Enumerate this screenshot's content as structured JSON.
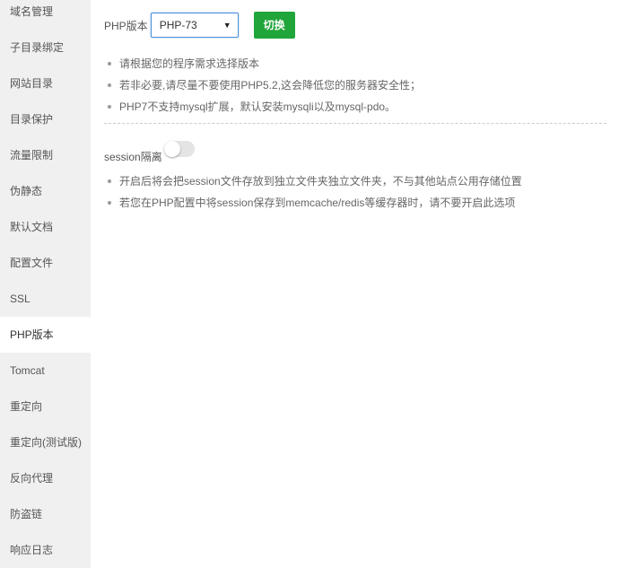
{
  "sidebar": {
    "items": [
      {
        "label": "域名管理"
      },
      {
        "label": "子目录绑定"
      },
      {
        "label": "网站目录"
      },
      {
        "label": "目录保护"
      },
      {
        "label": "流量限制"
      },
      {
        "label": "伪静态"
      },
      {
        "label": "默认文档"
      },
      {
        "label": "配置文件"
      },
      {
        "label": "SSL"
      },
      {
        "label": "PHP版本",
        "active": true
      },
      {
        "label": "Tomcat"
      },
      {
        "label": "重定向"
      },
      {
        "label": "重定向(测试版)"
      },
      {
        "label": "反向代理"
      },
      {
        "label": "防盗链"
      },
      {
        "label": "响应日志"
      }
    ]
  },
  "php": {
    "label": "PHP版本",
    "selected": "PHP-73",
    "switch_label": "切换",
    "tips": [
      "请根据您的程序需求选择版本",
      "若非必要,请尽量不要使用PHP5.2,这会降低您的服务器安全性；",
      "PHP7不支持mysql扩展，默认安装mysqli以及mysql-pdo。"
    ]
  },
  "session": {
    "label": "session隔离",
    "enabled": false,
    "tips": [
      "开启后将会把session文件存放到独立文件夹独立文件夹，不与其他站点公用存储位置",
      "若您在PHP配置中将session保存到memcache/redis等缓存器时，请不要开启此选项"
    ]
  },
  "colors": {
    "accent": "#20a53a",
    "sidebar_bg": "#f0f0f0",
    "select_border": "#4a90d9"
  }
}
